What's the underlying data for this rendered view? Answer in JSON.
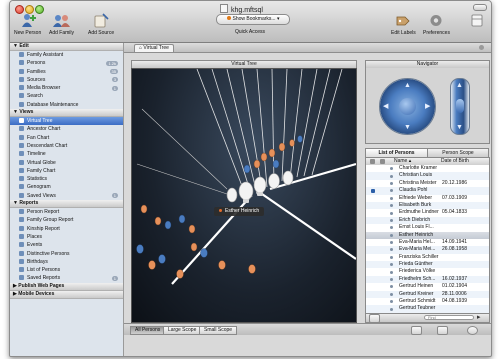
{
  "window": {
    "title": "khg.mftsql"
  },
  "toolbar": {
    "new_person": "New Person",
    "add_family": "Add Family",
    "add_source": "Add Source",
    "bookmarks": "Show Bookmarks...",
    "quick_access": "Quick Access",
    "edit_labels": "Edit Labels",
    "preferences": "Preferences"
  },
  "sidebar": {
    "edit": {
      "header": "Edit",
      "items": [
        {
          "label": "Family Assistant",
          "icon": "assistant-icon"
        },
        {
          "label": "Persons",
          "icon": "person-icon",
          "badge": "1.2k"
        },
        {
          "label": "Families",
          "icon": "family-icon",
          "badge": "35"
        },
        {
          "label": "Sources",
          "icon": "source-icon",
          "badge": "3"
        },
        {
          "label": "Media Browser",
          "icon": "media-icon",
          "badge": "1"
        },
        {
          "label": "Search",
          "icon": "search-icon"
        },
        {
          "label": "Database Maintenance",
          "icon": "database-icon"
        }
      ]
    },
    "views": {
      "header": "Views",
      "items": [
        {
          "label": "Virtual Tree",
          "icon": "virtual-tree-icon",
          "selected": true
        },
        {
          "label": "Ancestor Chart",
          "icon": "ancestor-chart-icon"
        },
        {
          "label": "Fan Chart",
          "icon": "fan-chart-icon"
        },
        {
          "label": "Descendant Chart",
          "icon": "descendant-chart-icon"
        },
        {
          "label": "Timeline",
          "icon": "timeline-icon"
        },
        {
          "label": "Virtual Globe",
          "icon": "globe-icon"
        },
        {
          "label": "Family Chart",
          "icon": "family-chart-icon"
        },
        {
          "label": "Statistics",
          "icon": "statistics-icon"
        },
        {
          "label": "Genogram",
          "icon": "genogram-icon"
        },
        {
          "label": "Saved Views",
          "icon": "saved-views-icon",
          "badge": "1"
        }
      ]
    },
    "reports": {
      "header": "Reports",
      "items": [
        {
          "label": "Person Report",
          "icon": "report-icon"
        },
        {
          "label": "Family Group Report",
          "icon": "report-icon"
        },
        {
          "label": "Kinship Report",
          "icon": "report-icon"
        },
        {
          "label": "Places",
          "icon": "places-icon"
        },
        {
          "label": "Events",
          "icon": "events-icon"
        },
        {
          "label": "Distinctive Persons",
          "icon": "report-icon"
        },
        {
          "label": "Birthdays",
          "icon": "birthday-icon"
        },
        {
          "label": "List of Persons",
          "icon": "report-icon"
        },
        {
          "label": "Saved Reports",
          "icon": "saved-reports-icon",
          "badge": "1"
        }
      ]
    },
    "collapsed": [
      "Publish Web Pages",
      "Mobile Devices"
    ]
  },
  "tabbar": {
    "tab": "Virtual Tree"
  },
  "virtual_tree": {
    "header": "Virtual Tree",
    "selected_person": "Esther Heinrich"
  },
  "navigator": {
    "header": "Navigator"
  },
  "persons_list": {
    "tabs": [
      "List of Persons",
      "Person Scope"
    ],
    "col_name": "Name",
    "col_dob": "Date of Birth",
    "rows": [
      {
        "name": "Charlotte Kramer",
        "dob": ""
      },
      {
        "name": "Christian Louis",
        "dob": ""
      },
      {
        "name": "Christina Meister",
        "dob": "20.12.1986"
      },
      {
        "name": "Claudia Pohl",
        "dob": "",
        "checked": true
      },
      {
        "name": "Elfriede Weber",
        "dob": "07.03.1909"
      },
      {
        "name": "Elisabeth Burk",
        "dob": ""
      },
      {
        "name": "Erdmuthe Lindner",
        "dob": "05.04.1833"
      },
      {
        "name": "Erich Diebrich",
        "dob": ""
      },
      {
        "name": "Ernst Louis Fl...",
        "dob": ""
      },
      {
        "name": "Esther Heinrich",
        "dob": "",
        "selected": true
      },
      {
        "name": "Eva-Maria Hel...",
        "dob": "14.09.1941"
      },
      {
        "name": "Eva-Maria Mei...",
        "dob": "26.08.1958"
      },
      {
        "name": "Franziska Schiller",
        "dob": ""
      },
      {
        "name": "Frieda Günther",
        "dob": ""
      },
      {
        "name": "Friederica Völke",
        "dob": ""
      },
      {
        "name": "Friedhelm Sch...",
        "dob": "16.02.1937"
      },
      {
        "name": "Gertrud Heinen",
        "dob": "01.02.1904"
      },
      {
        "name": "Gertrud Kreiner",
        "dob": "28.11.0006"
      },
      {
        "name": "Gertrud Schmidt",
        "dob": "04.08.1939"
      },
      {
        "name": "Gertrud Teubner",
        "dob": ""
      }
    ],
    "search_placeholder": "Find"
  },
  "bottombar": {
    "scopes": [
      "All Persons",
      "Large Scope",
      "Small Scope"
    ],
    "active_scope": "All Persons"
  },
  "colors": {
    "selection": "#3b6cc4",
    "tree_bg": "#1a222d",
    "female": "#e6905a",
    "male": "#4a7cc0"
  }
}
